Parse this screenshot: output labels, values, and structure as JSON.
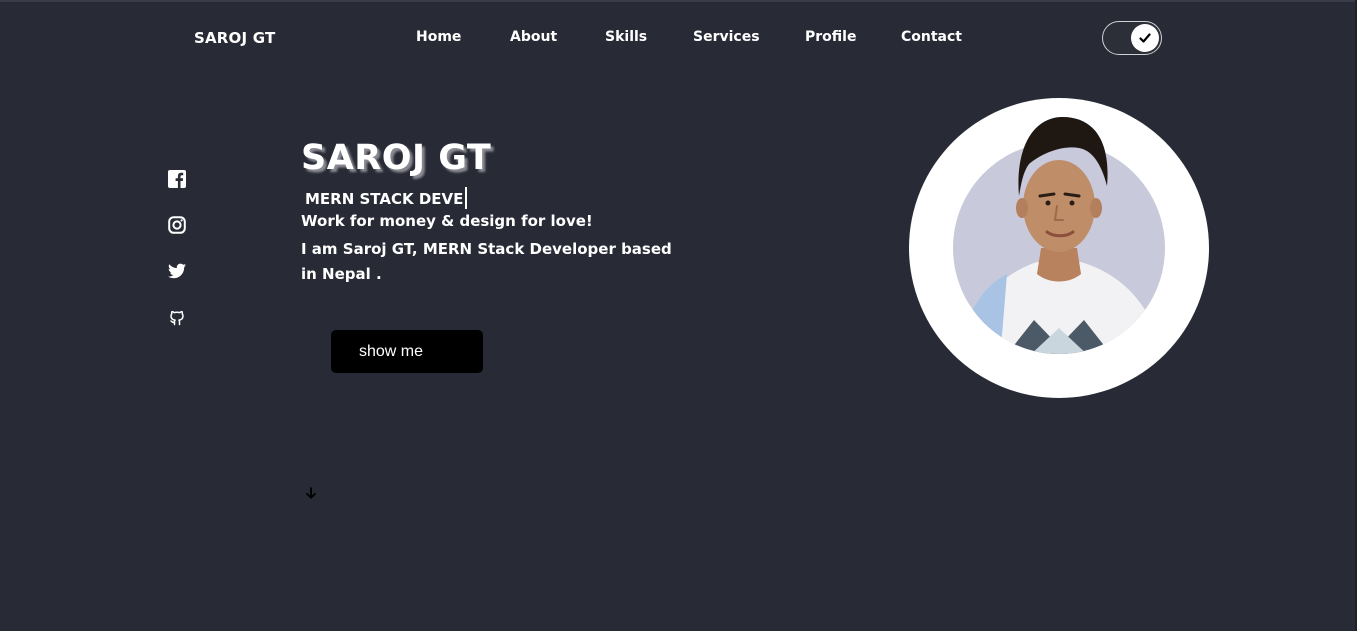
{
  "header": {
    "brand": "SAROJ GT",
    "nav": [
      "Home",
      "About",
      "Skills",
      "Services",
      "Profile",
      "Contact"
    ],
    "theme_toggle": {
      "state": "on",
      "icon": "check-icon"
    }
  },
  "socials": [
    {
      "icon": "facebook-icon"
    },
    {
      "icon": "instagram-icon"
    },
    {
      "icon": "twitter-icon"
    },
    {
      "icon": "github-icon"
    }
  ],
  "hero": {
    "name": "SAROJ GT",
    "typed_text": "MERN STACK DEVE",
    "tagline": "Work for money & design for love!",
    "bio": "I am Saroj GT, MERN Stack Developer based in Nepal .",
    "cta_label": "show me",
    "scroll_icon": "arrow-down-icon"
  },
  "colors": {
    "background": "#282a35",
    "text": "#ffffff",
    "button": "#000000",
    "avatar_ring": "#ffffff",
    "avatar_inner": "#c8c9db"
  }
}
